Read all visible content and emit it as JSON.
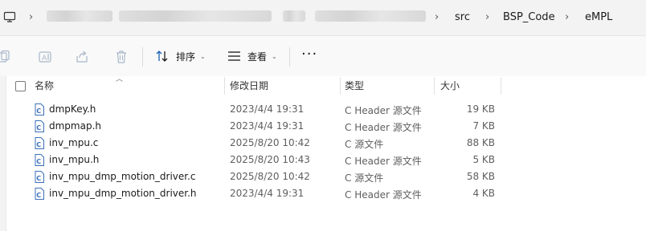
{
  "breadcrumb": {
    "items": [
      "src",
      "BSP_Code",
      "eMPL"
    ]
  },
  "toolbar": {
    "sort_label": "排序",
    "view_label": "查看",
    "more_label": "···"
  },
  "list": {
    "headers": {
      "name": "名称",
      "date": "修改日期",
      "type": "类型",
      "size": "大小"
    },
    "rows": [
      {
        "name": "dmpKey.h",
        "date": "2023/4/4 19:31",
        "type": "C Header 源文件",
        "size": "19 KB"
      },
      {
        "name": "dmpmap.h",
        "date": "2023/4/4 19:31",
        "type": "C Header 源文件",
        "size": "7 KB"
      },
      {
        "name": "inv_mpu.c",
        "date": "2025/8/20 10:42",
        "type": "C 源文件",
        "size": "88 KB"
      },
      {
        "name": "inv_mpu.h",
        "date": "2025/8/20 10:43",
        "type": "C Header 源文件",
        "size": "5 KB"
      },
      {
        "name": "inv_mpu_dmp_motion_driver.c",
        "date": "2025/8/20 10:42",
        "type": "C 源文件",
        "size": "58 KB"
      },
      {
        "name": "inv_mpu_dmp_motion_driver.h",
        "date": "2023/4/4 19:31",
        "type": "C Header 源文件",
        "size": "4 KB"
      }
    ]
  },
  "colors": {
    "file_icon_accent": "#3a6fb8",
    "toolbar_icon_disabled": "#a9b7c9"
  },
  "icons": [
    "computer-icon",
    "copy-icon",
    "rename-icon",
    "share-icon",
    "delete-icon",
    "sort-icon",
    "view-icon",
    "c-file-icon"
  ]
}
